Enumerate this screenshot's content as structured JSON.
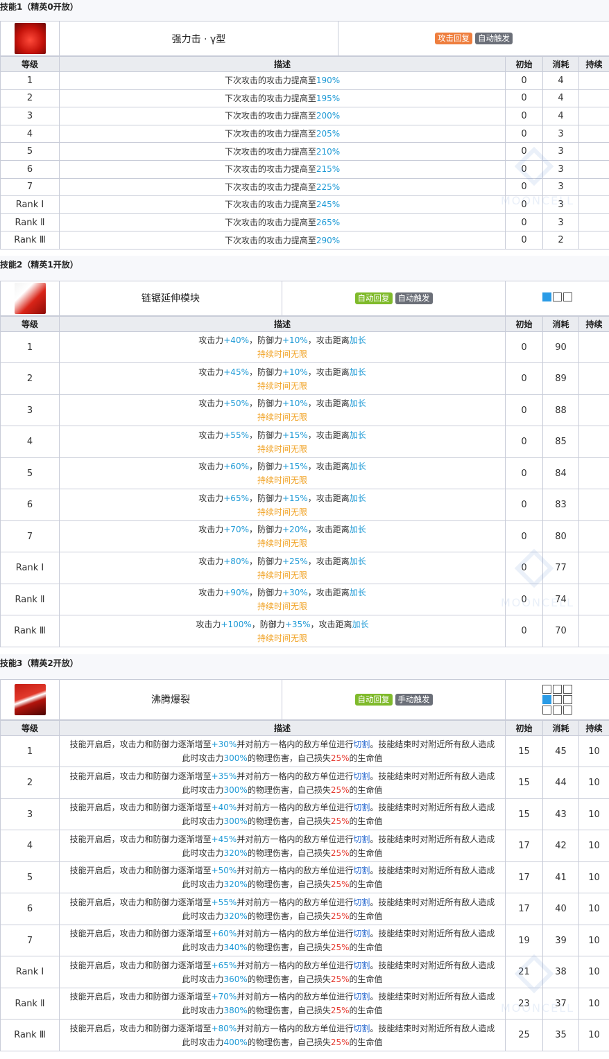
{
  "headers": {
    "level": "等级",
    "desc": "描述",
    "initial": "初始",
    "cost": "消耗",
    "duration": "持续"
  },
  "skill1": {
    "section_title": "技能1（精英0开放）",
    "name": "强力击 · γ型",
    "icon": "skill-icon-power-strike",
    "badges": [
      "攻击回复",
      "自动触发"
    ],
    "rows": [
      {
        "level": "1",
        "pre": "下次攻击的攻击力提高至",
        "val": "190%",
        "init": "0",
        "cost": "4",
        "dur": ""
      },
      {
        "level": "2",
        "pre": "下次攻击的攻击力提高至",
        "val": "195%",
        "init": "0",
        "cost": "4",
        "dur": ""
      },
      {
        "level": "3",
        "pre": "下次攻击的攻击力提高至",
        "val": "200%",
        "init": "0",
        "cost": "4",
        "dur": ""
      },
      {
        "level": "4",
        "pre": "下次攻击的攻击力提高至",
        "val": "205%",
        "init": "0",
        "cost": "3",
        "dur": ""
      },
      {
        "level": "5",
        "pre": "下次攻击的攻击力提高至",
        "val": "210%",
        "init": "0",
        "cost": "3",
        "dur": ""
      },
      {
        "level": "6",
        "pre": "下次攻击的攻击力提高至",
        "val": "215%",
        "init": "0",
        "cost": "3",
        "dur": ""
      },
      {
        "level": "7",
        "pre": "下次攻击的攻击力提高至",
        "val": "225%",
        "init": "0",
        "cost": "3",
        "dur": ""
      },
      {
        "level": "Rank Ⅰ",
        "pre": "下次攻击的攻击力提高至",
        "val": "245%",
        "init": "0",
        "cost": "3",
        "dur": ""
      },
      {
        "level": "Rank Ⅱ",
        "pre": "下次攻击的攻击力提高至",
        "val": "265%",
        "init": "0",
        "cost": "3",
        "dur": ""
      },
      {
        "level": "Rank Ⅲ",
        "pre": "下次攻击的攻击力提高至",
        "val": "290%",
        "init": "0",
        "cost": "2",
        "dur": ""
      }
    ]
  },
  "skill2": {
    "section_title": "技能2（精英1开放）",
    "name": "链锯延伸模块",
    "icon": "skill-icon-chainsaw",
    "badges": [
      "自动回复",
      "自动触发"
    ],
    "range": [
      1,
      0,
      0
    ],
    "t_atk": "攻击力",
    "t_def": "，防御力",
    "t_range": "，攻击距离",
    "t_extend": "加长",
    "t_duration": "持续时间无限",
    "rows": [
      {
        "level": "1",
        "atk": "+40%",
        "def": "+10%",
        "init": "0",
        "cost": "90",
        "dur": ""
      },
      {
        "level": "2",
        "atk": "+45%",
        "def": "+10%",
        "init": "0",
        "cost": "89",
        "dur": ""
      },
      {
        "level": "3",
        "atk": "+50%",
        "def": "+10%",
        "init": "0",
        "cost": "88",
        "dur": ""
      },
      {
        "level": "4",
        "atk": "+55%",
        "def": "+15%",
        "init": "0",
        "cost": "85",
        "dur": ""
      },
      {
        "level": "5",
        "atk": "+60%",
        "def": "+15%",
        "init": "0",
        "cost": "84",
        "dur": ""
      },
      {
        "level": "6",
        "atk": "+65%",
        "def": "+15%",
        "init": "0",
        "cost": "83",
        "dur": ""
      },
      {
        "level": "7",
        "atk": "+70%",
        "def": "+20%",
        "init": "0",
        "cost": "80",
        "dur": ""
      },
      {
        "level": "Rank Ⅰ",
        "atk": "+80%",
        "def": "+25%",
        "init": "0",
        "cost": "77",
        "dur": ""
      },
      {
        "level": "Rank Ⅱ",
        "atk": "+90%",
        "def": "+30%",
        "init": "0",
        "cost": "74",
        "dur": ""
      },
      {
        "level": "Rank Ⅲ",
        "atk": "+100%",
        "def": "+35%",
        "init": "0",
        "cost": "70",
        "dur": ""
      }
    ]
  },
  "skill3": {
    "section_title": "技能3（精英2开放）",
    "name": "沸腾爆裂",
    "icon": "skill-icon-boiling-burst",
    "badges": [
      "自动回复",
      "手动触发"
    ],
    "range": [
      [
        0,
        0,
        0
      ],
      [
        1,
        0,
        0
      ],
      [
        0,
        0,
        0
      ]
    ],
    "t1": "技能开启后，攻击力和防御力逐渐增至",
    "t2": "并对前方一格内的敌方单位进行",
    "t_cut": "切割",
    "t3": "。技能结束时对附近所有敌人造成",
    "t4": "此时攻击力",
    "t5": "的物理伤害，自己损失",
    "t_hp": "25%",
    "t6": "的生命值",
    "rows": [
      {
        "level": "1",
        "inc": "+30%",
        "dmg": "300%",
        "init": "15",
        "cost": "45",
        "dur": "10"
      },
      {
        "level": "2",
        "inc": "+35%",
        "dmg": "300%",
        "init": "15",
        "cost": "44",
        "dur": "10"
      },
      {
        "level": "3",
        "inc": "+40%",
        "dmg": "300%",
        "init": "15",
        "cost": "43",
        "dur": "10"
      },
      {
        "level": "4",
        "inc": "+45%",
        "dmg": "320%",
        "init": "17",
        "cost": "42",
        "dur": "10"
      },
      {
        "level": "5",
        "inc": "+50%",
        "dmg": "320%",
        "init": "17",
        "cost": "41",
        "dur": "10"
      },
      {
        "level": "6",
        "inc": "+55%",
        "dmg": "320%",
        "init": "17",
        "cost": "40",
        "dur": "10"
      },
      {
        "level": "7",
        "inc": "+60%",
        "dmg": "340%",
        "init": "19",
        "cost": "39",
        "dur": "10"
      },
      {
        "level": "Rank Ⅰ",
        "inc": "+65%",
        "dmg": "360%",
        "init": "21",
        "cost": "38",
        "dur": "10"
      },
      {
        "level": "Rank Ⅱ",
        "inc": "+70%",
        "dmg": "380%",
        "init": "23",
        "cost": "37",
        "dur": "10"
      },
      {
        "level": "Rank Ⅲ",
        "inc": "+80%",
        "dmg": "400%",
        "init": "25",
        "cost": "35",
        "dur": "10"
      }
    ]
  },
  "watermark_text": "MOONCELL"
}
